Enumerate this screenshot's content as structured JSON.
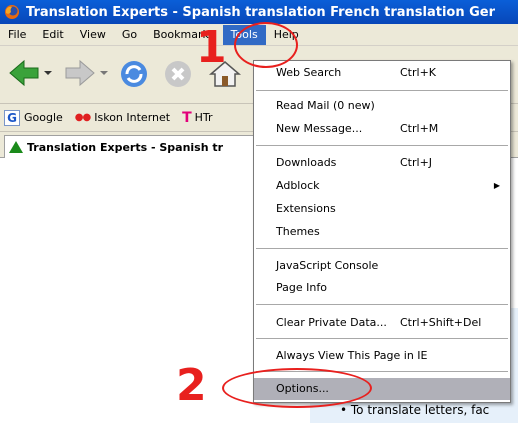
{
  "window": {
    "title": "Translation Experts - Spanish translation French translation Ger"
  },
  "menubar": {
    "items": [
      "File",
      "Edit",
      "View",
      "Go",
      "Bookmarks",
      "Tools",
      "Help"
    ],
    "active": "Tools"
  },
  "toolbar": {
    "icons": [
      "back-arrow-icon",
      "forward-arrow-icon",
      "reload-icon",
      "stop-icon",
      "home-icon"
    ]
  },
  "bookmarks": {
    "items": [
      {
        "label": "Google",
        "icon": "google-icon"
      },
      {
        "label": "Iskon Internet",
        "icon": "iskon-icon"
      },
      {
        "label": "HTr",
        "icon": "t-mobile-icon"
      }
    ]
  },
  "tab": {
    "label": "Translation Experts - Spanish tr"
  },
  "tools_menu": {
    "items": [
      {
        "label": "Web Search",
        "shortcut": "Ctrl+K"
      },
      {
        "label": "Read Mail (0 new)",
        "shortcut": ""
      },
      {
        "label": "New Message...",
        "shortcut": "Ctrl+M"
      },
      {
        "label": "Downloads",
        "shortcut": "Ctrl+J"
      },
      {
        "label": "Adblock",
        "shortcut": ""
      },
      {
        "label": "Extensions",
        "shortcut": ""
      },
      {
        "label": "Themes",
        "shortcut": ""
      },
      {
        "label": "JavaScript Console",
        "shortcut": ""
      },
      {
        "label": "Page Info",
        "shortcut": ""
      },
      {
        "label": "Clear Private Data...",
        "shortcut": "Ctrl+Shift+Del"
      },
      {
        "label": "Always View This Page in IE",
        "shortcut": ""
      },
      {
        "label": "Options...",
        "shortcut": ""
      }
    ],
    "highlighted": "Options..."
  },
  "page": {
    "bullet_text": "• To translate letters, fac",
    "edge_chars": [
      "s",
      "s"
    ]
  },
  "annotations": {
    "step1": "1",
    "step2": "2",
    "color": "#e8201e"
  }
}
